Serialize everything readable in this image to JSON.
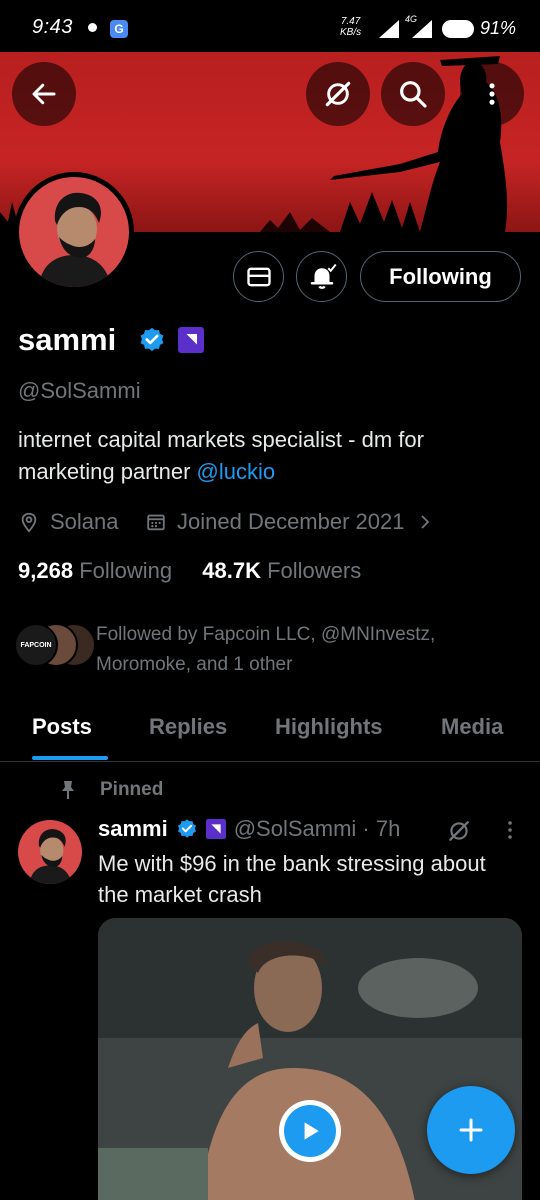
{
  "status_bar": {
    "time": "9:43",
    "speed_value": "7.47",
    "speed_unit": "KB/s",
    "network": "4G",
    "battery": "91%"
  },
  "header": {
    "icons": [
      "back-arrow-icon",
      "grok-icon",
      "search-icon",
      "more-vertical-icon"
    ]
  },
  "profile": {
    "name": "sammi",
    "handle": "@SolSammi",
    "bio_text": "internet capital markets specialist - dm for marketing  partner ",
    "bio_link": "@luckio",
    "location": "Solana",
    "joined": "Joined December 2021",
    "following_count": "9,268",
    "following_label": "Following",
    "followers_count": "48.7K",
    "followers_label": "Followers",
    "followed_by": "Followed by Fapcoin LLC, @MNInvestz, Moromoke, and 1 other",
    "followed_avatar_text": "FAPCOIN",
    "follow_button_label": "Following"
  },
  "tabs": [
    {
      "label": "Posts",
      "active": true
    },
    {
      "label": "Replies",
      "active": false
    },
    {
      "label": "Highlights",
      "active": false
    },
    {
      "label": "Media",
      "active": false
    }
  ],
  "pinned_post": {
    "pinned_label": "Pinned",
    "author_name": "sammi",
    "author_handle": "@SolSammi · 7h",
    "text": "Me with $96 in the bank stressing about the market crash"
  },
  "colors": {
    "accent": "#1d9bf0",
    "banner": "#c62424",
    "muted": "#71767b",
    "background": "#000000"
  }
}
